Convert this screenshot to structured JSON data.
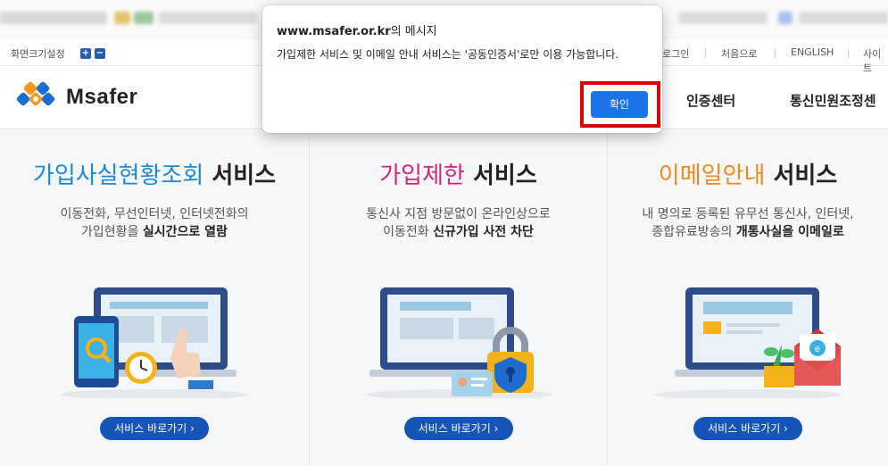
{
  "util_bar": {
    "font_size_label": "화면크기설정",
    "zoom_in": "+",
    "zoom_out": "−",
    "links": [
      "로그인",
      "처음으로",
      "ENGLISH",
      "사이트"
    ]
  },
  "header": {
    "logo_text": "Msafer",
    "nav": [
      "인증센터",
      "통신민원조정센"
    ]
  },
  "services": [
    {
      "title_highlight": "가입사실현황조회",
      "title_rest": " 서비스",
      "highlight_color": "#1a8ad6",
      "desc_line1": "이동전화, 무선인터넷, 인터넷전화의",
      "desc_line2_plain": "가입현황을 ",
      "desc_line2_bold": "실시간으로 열람",
      "button": "서비스 바로가기 ›"
    },
    {
      "title_highlight": "가입제한",
      "title_rest": " 서비스",
      "highlight_color": "#d6237a",
      "desc_line1": "통신사 지점 방문없이 온라인상으로",
      "desc_line2_plain": "이동전화 ",
      "desc_line2_bold": "신규가입 사전 차단",
      "button": "서비스 바로가기 ›"
    },
    {
      "title_highlight": "이메일안내",
      "title_rest": " 서비스",
      "highlight_color": "#f08a1c",
      "desc_line1": "내 명의로 등록된 유무선 통신사, 인터넷,",
      "desc_line2_plain": "종합유료방송의 ",
      "desc_line2_bold": "개통사실을 이메일로",
      "button": "서비스 바로가기 ›"
    }
  ],
  "dialog": {
    "host": "www.msafer.or.kr",
    "title_suffix": "의 메시지",
    "message": "가입제한 서비스 및 이메일 안내 서비스는 '공동인증서'로만 이용 가능합니다.",
    "ok_label": "확인"
  },
  "colors": {
    "primary_button": "#1754b8",
    "dialog_button": "#1a73e8",
    "highlight_box": "#e00000"
  }
}
